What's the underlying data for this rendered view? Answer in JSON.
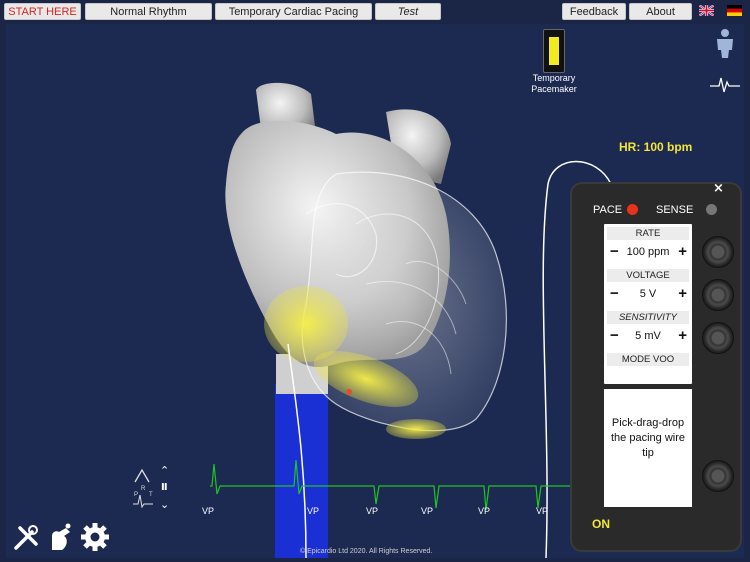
{
  "topbar": {
    "start_here": "START HERE",
    "normal_rhythm": "Normal Rhythm",
    "temporary_pacing": "Temporary Cardiac Pacing",
    "test": "Test",
    "feedback": "Feedback",
    "about": "About"
  },
  "pacemaker_toggle_label": "Temporary Pacemaker",
  "heart_rate": "HR: 100 bpm",
  "device": {
    "pace_label": "PACE",
    "sense_label": "SENSE",
    "rate_label": "RATE",
    "rate_value": "100 ppm",
    "voltage_label": "VOLTAGE",
    "voltage_value": "5 V",
    "sensitivity_label": "SENSITIVITY",
    "sensitivity_value": "5 mV",
    "mode_label": "MODE VOO",
    "instruction": "Pick-drag-drop the pacing wire tip",
    "on_label": "ON",
    "minus": "−",
    "plus": "+",
    "close": "×"
  },
  "ecg": {
    "vp_marks": [
      "VP",
      "VP",
      "VP",
      "VP",
      "VP",
      "VP"
    ],
    "lead_letters": [
      "P",
      "R",
      "T"
    ]
  },
  "copyright": "© Epicardio Ltd 2020. All Rights Reserved.",
  "colors": {
    "background": "#1c2a52",
    "ecg_trace": "#21c421",
    "pace_led": "#e8321e",
    "hr_text": "#f3e53a",
    "on_text": "#f3e53a",
    "pacing_wire": "#1a2fd4"
  }
}
